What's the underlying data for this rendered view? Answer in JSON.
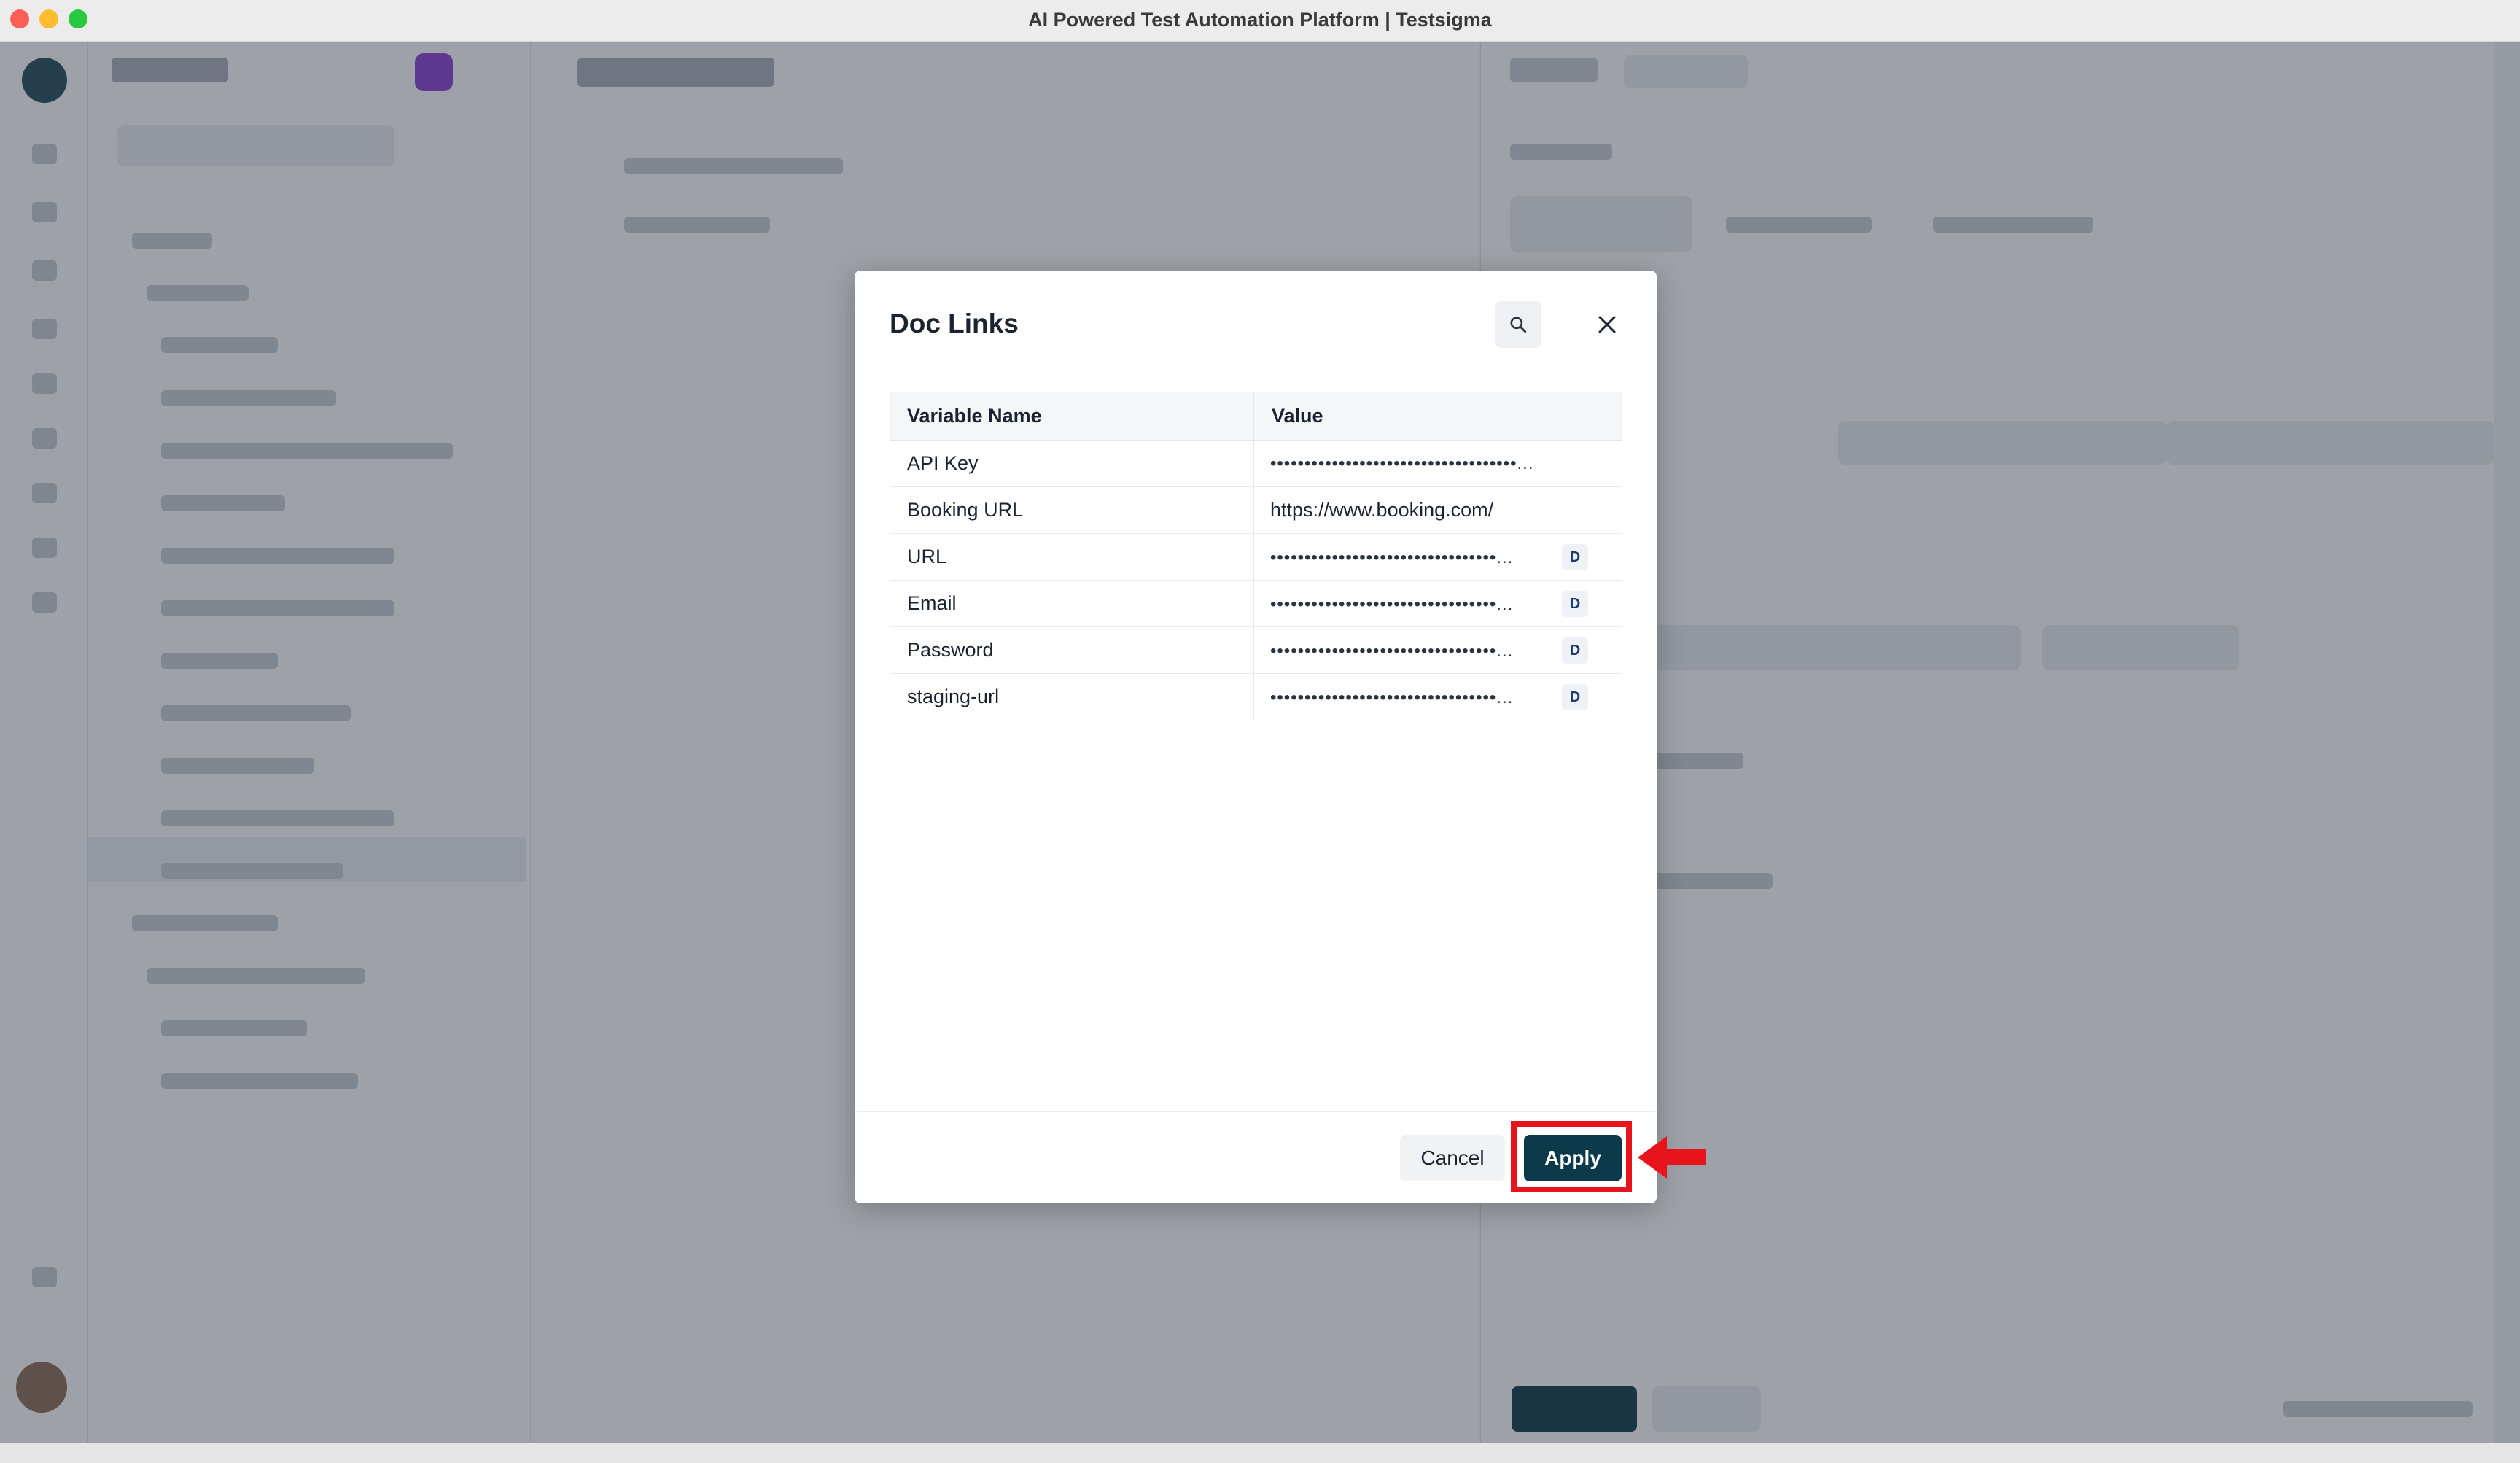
{
  "window": {
    "title": "AI Powered Test Automation Platform | Testsigma"
  },
  "dialog": {
    "title": "Doc Links",
    "columns": [
      "Variable Name",
      "Value"
    ],
    "rows": [
      {
        "name": "API Key",
        "value": "••••••••••••••••••••••••••••••••••••...",
        "badge": ""
      },
      {
        "name": "Booking URL",
        "value": "https://www.booking.com/",
        "badge": ""
      },
      {
        "name": "URL",
        "value": "•••••••••••••••••••••••••••••••••...",
        "badge": "D"
      },
      {
        "name": "Email",
        "value": "•••••••••••••••••••••••••••••••••...",
        "badge": "D"
      },
      {
        "name": "Password",
        "value": "•••••••••••••••••••••••••••••••••...",
        "badge": "D"
      },
      {
        "name": "staging-url",
        "value": "•••••••••••••••••••••••••••••••••...",
        "badge": "D"
      }
    ],
    "cancel_label": "Cancel",
    "apply_label": "Apply"
  },
  "icons": {
    "search": "search-icon",
    "close": "close-icon",
    "arrow": "arrow-left-icon"
  },
  "colors": {
    "primary": "#0d3a4a",
    "highlight": "#e8141b",
    "overlay": "#28303e"
  }
}
